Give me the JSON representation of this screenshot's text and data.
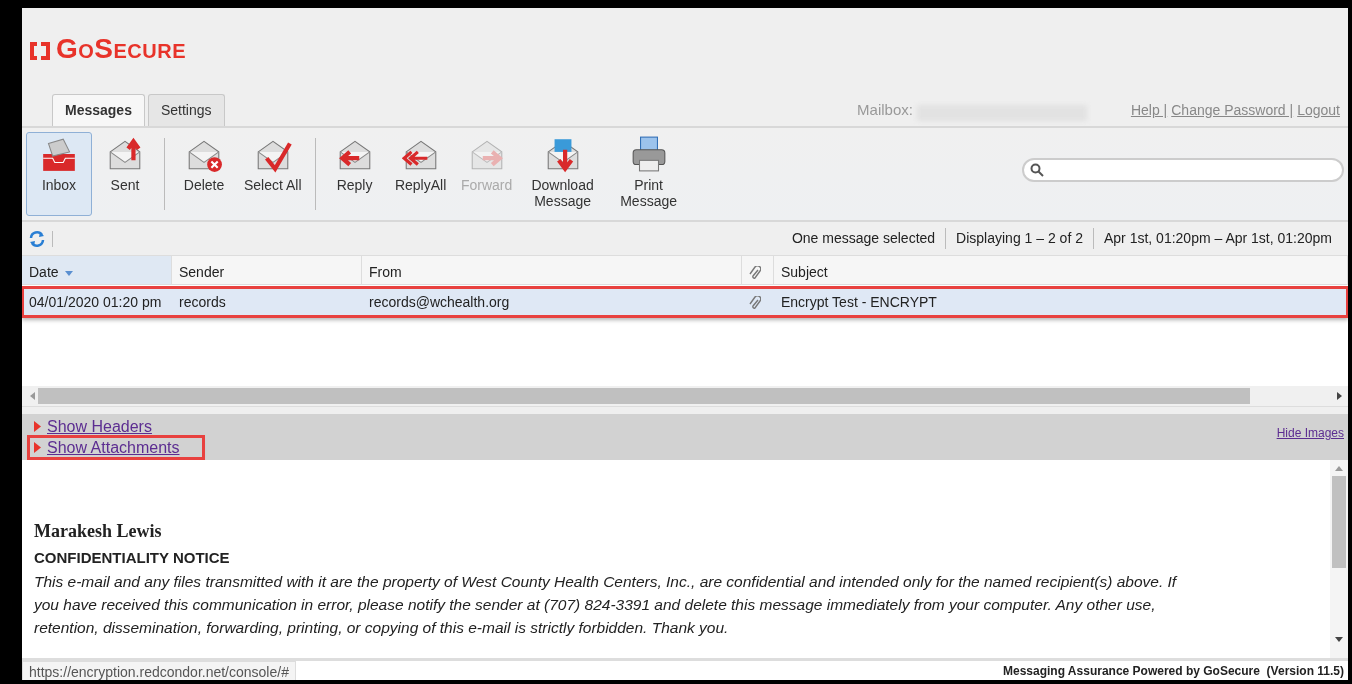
{
  "logo": "GoSecure",
  "tabs": [
    {
      "label": "Messages",
      "selected": true
    },
    {
      "label": "Settings",
      "selected": false
    }
  ],
  "mailbox_label": "Mailbox:",
  "top_links": [
    "Help |",
    "Change Password |",
    "Logout"
  ],
  "toolbar": [
    [
      {
        "kind": "inbox",
        "label": "Inbox",
        "selected": true,
        "disabled": false
      },
      {
        "kind": "sent",
        "label": "Sent",
        "selected": false,
        "disabled": false
      }
    ],
    [
      {
        "kind": "delete",
        "label": "Delete",
        "selected": false,
        "disabled": false
      },
      {
        "kind": "selectall",
        "label": "Select All",
        "selected": false,
        "disabled": false
      }
    ],
    [
      {
        "kind": "reply",
        "label": "Reply",
        "selected": false,
        "disabled": false
      },
      {
        "kind": "replyall",
        "label": "ReplyAll",
        "selected": false,
        "disabled": false
      },
      {
        "kind": "forward",
        "label": "Forward",
        "selected": false,
        "disabled": true
      },
      {
        "kind": "download",
        "label": "Download Message",
        "selected": false,
        "disabled": false
      },
      {
        "kind": "print",
        "label": "Print Message",
        "selected": false,
        "disabled": false
      }
    ]
  ],
  "status": [
    "One message selected",
    "Displaying 1 – 2 of 2",
    "Apr 1st, 01:20pm – Apr 1st, 01:20pm"
  ],
  "columns": [
    {
      "kind": "text",
      "label": "Date",
      "sorted": true
    },
    {
      "kind": "text",
      "label": "Sender",
      "sorted": false
    },
    {
      "kind": "text",
      "label": "From",
      "sorted": false
    },
    {
      "kind": "attachment",
      "sorted": false
    },
    {
      "kind": "text",
      "label": "Subject",
      "sorted": false
    }
  ],
  "rows": [
    {
      "date": "04/01/2020 01:20 pm",
      "sender": "records",
      "from": "records@wchealth.org",
      "has_attachment": true,
      "subject": "Encrypt Test - ENCRYPT",
      "selected": true,
      "annotated": true
    }
  ],
  "preview_links": [
    {
      "label": "Show Headers",
      "annotated": false
    },
    {
      "label": "Show Attachments",
      "annotated": true
    }
  ],
  "hide_images": "Hide Images",
  "message": {
    "sender_name": "Marakesh Lewis",
    "heading": "CONFIDENTIALITY NOTICE",
    "notice_lines": [
      "This e-mail and any files transmitted with it are the property of West County Health Centers, Inc., are confidential and intended only for the named recipient(s) above.  If",
      "you have received this communication in error, please notify the sender at (707) 824-3391 and delete this message immediately from your computer.  Any other use,",
      "retention, dissemination, forwarding, printing, or copying of this e-mail is strictly forbidden.  Thank you."
    ]
  },
  "status_url": "https://encryption.redcondor.net/console/#",
  "footer": "Messaging Assurance Powered by GoSecure  (Version 11.5)"
}
